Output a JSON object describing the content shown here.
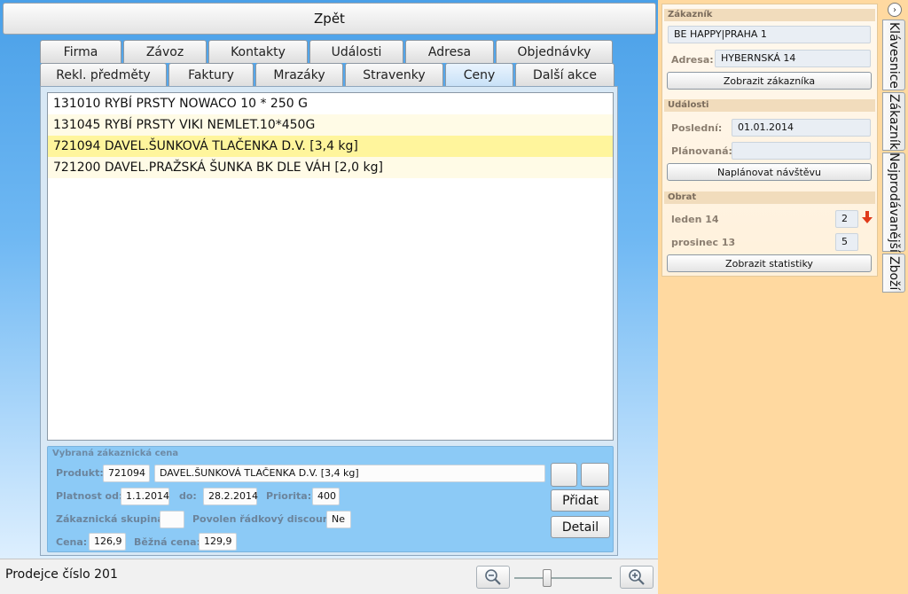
{
  "back_label": "Zpět",
  "tabs_row1": [
    "Firma",
    "Závoz",
    "Kontakty",
    "Události",
    "Adresa",
    "Objednávky"
  ],
  "tabs_row2": [
    "Rekl. předměty",
    "Faktury",
    "Mrazáky",
    "Stravenky",
    "Ceny",
    "Další akce"
  ],
  "active_tab": "Ceny",
  "price_list": [
    "131010 RYBÍ PRSTY NOWACO 10 * 250 G",
    "131045 RYBÍ PRSTY VIKI NEMLET.10*450G",
    "721094 DAVEL.ŠUNKOVÁ TLAČENKA D.V. [3,4 kg]",
    "721200 DAVEL.PRAŽSKÁ ŠUNKA BK DLE VÁH [2,0 kg]"
  ],
  "selected_index": 2,
  "detail": {
    "title": "Vybraná zákaznická cena",
    "product_label": "Produkt:",
    "product_code": "721094",
    "product_name": "DAVEL.ŠUNKOVÁ TLAČENKA D.V. [3,4 kg]",
    "valid_from_label": "Platnost od:",
    "valid_from": "1.1.2014",
    "to_label": "do:",
    "valid_to": "28.2.2014",
    "priority_label": "Priorita:",
    "priority": "400",
    "group_label": "Zákaznická skupina:",
    "group": "",
    "discount_label": "Povolen řádkový discount:",
    "discount": "Ne",
    "price_label": "Cena:",
    "price": "126,9",
    "regular_price_label": "Běžná cena:",
    "regular_price": "129,9",
    "add_label": "Přidat",
    "detail_label": "Detail"
  },
  "status": {
    "text": "Prodejce číslo 201"
  },
  "customer": {
    "title": "Zákazník",
    "name": "BE HAPPY|PRAHA 1",
    "address_label": "Adresa:",
    "address": "HYBERNSKÁ 14",
    "show_label": "Zobrazit zákazníka"
  },
  "events": {
    "title": "Události",
    "last_label": "Poslední:",
    "last": "01.01.2014",
    "planned_label": "Plánovaná:",
    "planned": "",
    "plan_label": "Naplánovat návštěvu"
  },
  "turnover": {
    "title": "Obrat",
    "m1_label": "leden 14",
    "m1_value": "2",
    "m2_label": "prosinec 13",
    "m2_value": "5",
    "stats_label": "Zobrazit statistiky",
    "trend_color": "#e03a1a"
  },
  "side_tabs": [
    "Klávesnice",
    "Zákazník",
    "Nejprodávanější",
    "Zboží"
  ]
}
